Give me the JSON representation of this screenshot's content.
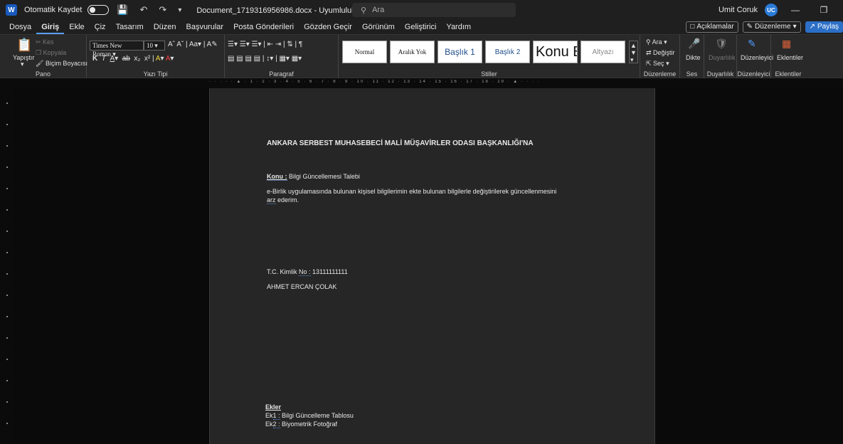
{
  "titlebar": {
    "autosave_label": "Otomatik Kaydet",
    "autosave_state": "Kapalı",
    "doc_title": "Document_1719316956986.docx",
    "mode": "Uyumluluk Modu",
    "search_placeholder": "Ara",
    "user_name": "Umit Coruk",
    "user_initials": "UC"
  },
  "menu": {
    "items": [
      "Dosya",
      "Giriş",
      "Ekle",
      "Çiz",
      "Tasarım",
      "Düzen",
      "Başvurular",
      "Posta Gönderileri",
      "Gözden Geçir",
      "Görünüm",
      "Geliştirici",
      "Yardım"
    ],
    "active": "Giriş",
    "comments_label": "Açıklamalar",
    "editing_label": "Düzenleme",
    "share_label": "Paylaş"
  },
  "ribbon": {
    "clipboard": {
      "paste": "Yapıştır",
      "cut": "Kes",
      "copy": "Kopyala",
      "format_painter": "Biçim Boyacısı",
      "label": "Pano"
    },
    "font": {
      "name": "Times New Roman",
      "size": "10",
      "label": "Yazı Tipi"
    },
    "paragraph": {
      "label": "Paragraf"
    },
    "styles": {
      "items": [
        "Normal",
        "Aralık Yok",
        "Başlık 1",
        "Başlık 2",
        "Konu B",
        "Altyazı"
      ],
      "label": "Stiller"
    },
    "editing": {
      "find": "Ara",
      "replace": "Değiştir",
      "select": "Seç",
      "label": "Düzenleme"
    },
    "voice": {
      "dictate": "Dikte",
      "label": "Ses"
    },
    "sensitivity": {
      "button": "Duyarlılık",
      "label": "Duyarlılık"
    },
    "editor": {
      "button": "Düzenleyici",
      "label": "Düzenleyici"
    },
    "addins": {
      "button": "Eklentiler",
      "label": "Eklentiler"
    }
  },
  "document": {
    "heading": "ANKARA SERBEST MUHASEBECİ MALİ MÜŞAVİRLER ODASI BAŞKANLIĞI'NA",
    "subject_label": "Konu :",
    "subject_text": " Bilgi Güncellemesi Talebi",
    "body_line1": "e-Birlik uygulamasında bulunan kişisel bilgilerimin ekte bulunan bilgilerle değiştirilerek  güncellenmesini",
    "body_line2_word": "arz",
    "body_line2_rest": " ederim.",
    "tc_label_prefix": "T.C. Kimlik ",
    "tc_label_no": "No :",
    "tc_value": " 13111111111",
    "name": "AHMET ERCAN ÇOLAK",
    "attachments_title": "Ekler",
    "attachment1_prefix": "Ek",
    "attachment1_num": "1 :",
    "attachment1_text": " Bilgi Güncelleme Tablosu",
    "attachment2_prefix": "Ek",
    "attachment2_num": "2 :",
    "attachment2_text": " Biyometrik Fotoğraf"
  }
}
